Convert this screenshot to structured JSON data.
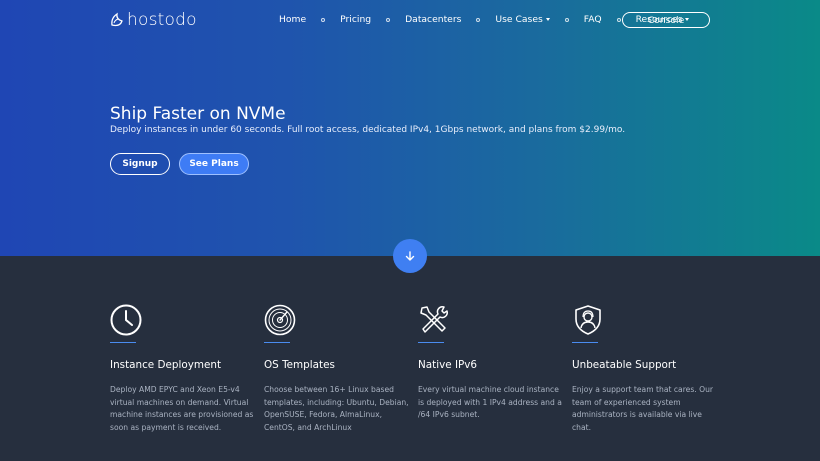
{
  "nav": {
    "logo_text": "hostodo",
    "links": [
      "Home",
      "Pricing",
      "Datacenters",
      "Use Cases",
      "FAQ",
      "Resources"
    ],
    "console_label": "Console"
  },
  "hero": {
    "title": "Ship Faster on NVMe",
    "subtitle": "Deploy instances in under 60 seconds. Full root access, dedicated IPv4, 1Gbps network, and plans from $2.99/mo.",
    "signup_label": "Signup",
    "plans_label": "See Plans"
  },
  "features": [
    {
      "icon": "clock-icon",
      "title": "Instance Deployment",
      "text": "Deploy AMD EPYC and Xeon E5-v4 virtual machines on demand. Virtual machine instances are provisioned as soon as payment is received."
    },
    {
      "icon": "disc-icon",
      "title": "OS Templates",
      "text": "Choose between 16+ Linux based templates, including: Ubuntu, Debian, OpenSUSE, Fedora, AlmaLinux, CentOS, and ArchLinux"
    },
    {
      "icon": "tools-icon",
      "title": "Native IPv6",
      "text": "Every virtual machine cloud instance is deployed with 1 IPv4 address and a /64 IPv6 subnet."
    },
    {
      "icon": "support-shield-icon",
      "title": "Unbeatable Support",
      "text": "Enjoy a support team that cares. Our team of experienced system administrators is available via live chat."
    }
  ],
  "colors": {
    "hero_start": "#1f46b4",
    "hero_end": "#0a8a88",
    "accent": "#3e7cf5",
    "dark_bg": "#262f3e"
  }
}
